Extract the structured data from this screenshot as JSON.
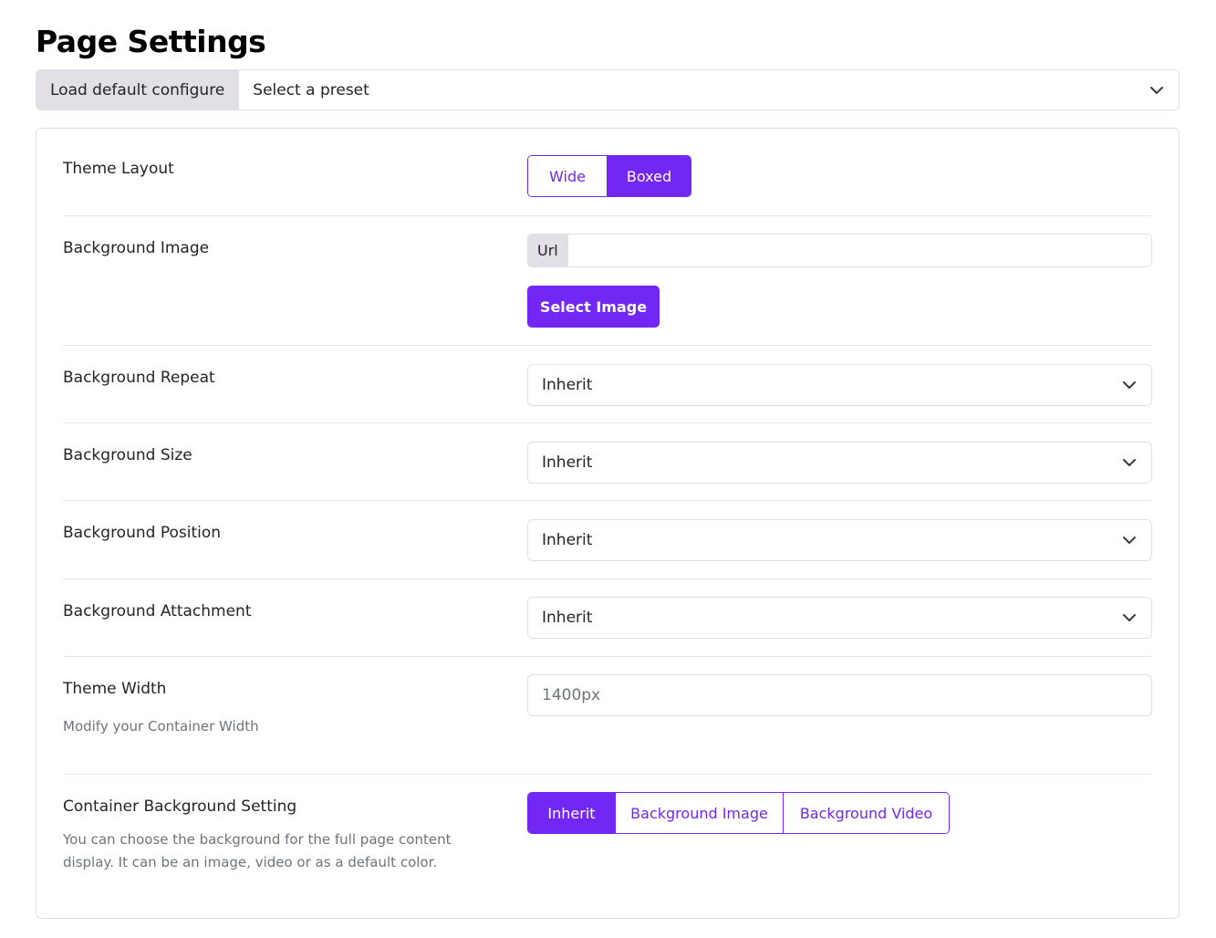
{
  "page": {
    "title": "Page Settings"
  },
  "preset": {
    "label": "Load default configure",
    "value": "Select a preset"
  },
  "settings": {
    "theme_layout": {
      "label": "Theme Layout",
      "options": [
        "Wide",
        "Boxed"
      ],
      "selected": "Boxed"
    },
    "background_image": {
      "label": "Background Image",
      "url_addon": "Url",
      "url_value": "",
      "button": "Select Image"
    },
    "background_repeat": {
      "label": "Background Repeat",
      "value": "Inherit"
    },
    "background_size": {
      "label": "Background Size",
      "value": "Inherit"
    },
    "background_position": {
      "label": "Background Position",
      "value": "Inherit"
    },
    "background_attachment": {
      "label": "Background Attachment",
      "value": "Inherit"
    },
    "theme_width": {
      "label": "Theme Width",
      "help": "Modify your Container Width",
      "placeholder": "1400px"
    },
    "container_background": {
      "label": "Container Background Setting",
      "help_line1": "You can choose the background for the full page content",
      "help_line2": "display. It can be an image, video or as a default color.",
      "options": [
        "Inherit",
        "Background Image",
        "Background Video"
      ],
      "selected": "Inherit"
    }
  },
  "colors": {
    "accent": "#7327f5",
    "addon_bg": "#e3dfe6",
    "border": "#dee2e6",
    "muted_text": "#6c757d"
  },
  "icons": {
    "dropdown": "chevron-down-icon"
  }
}
